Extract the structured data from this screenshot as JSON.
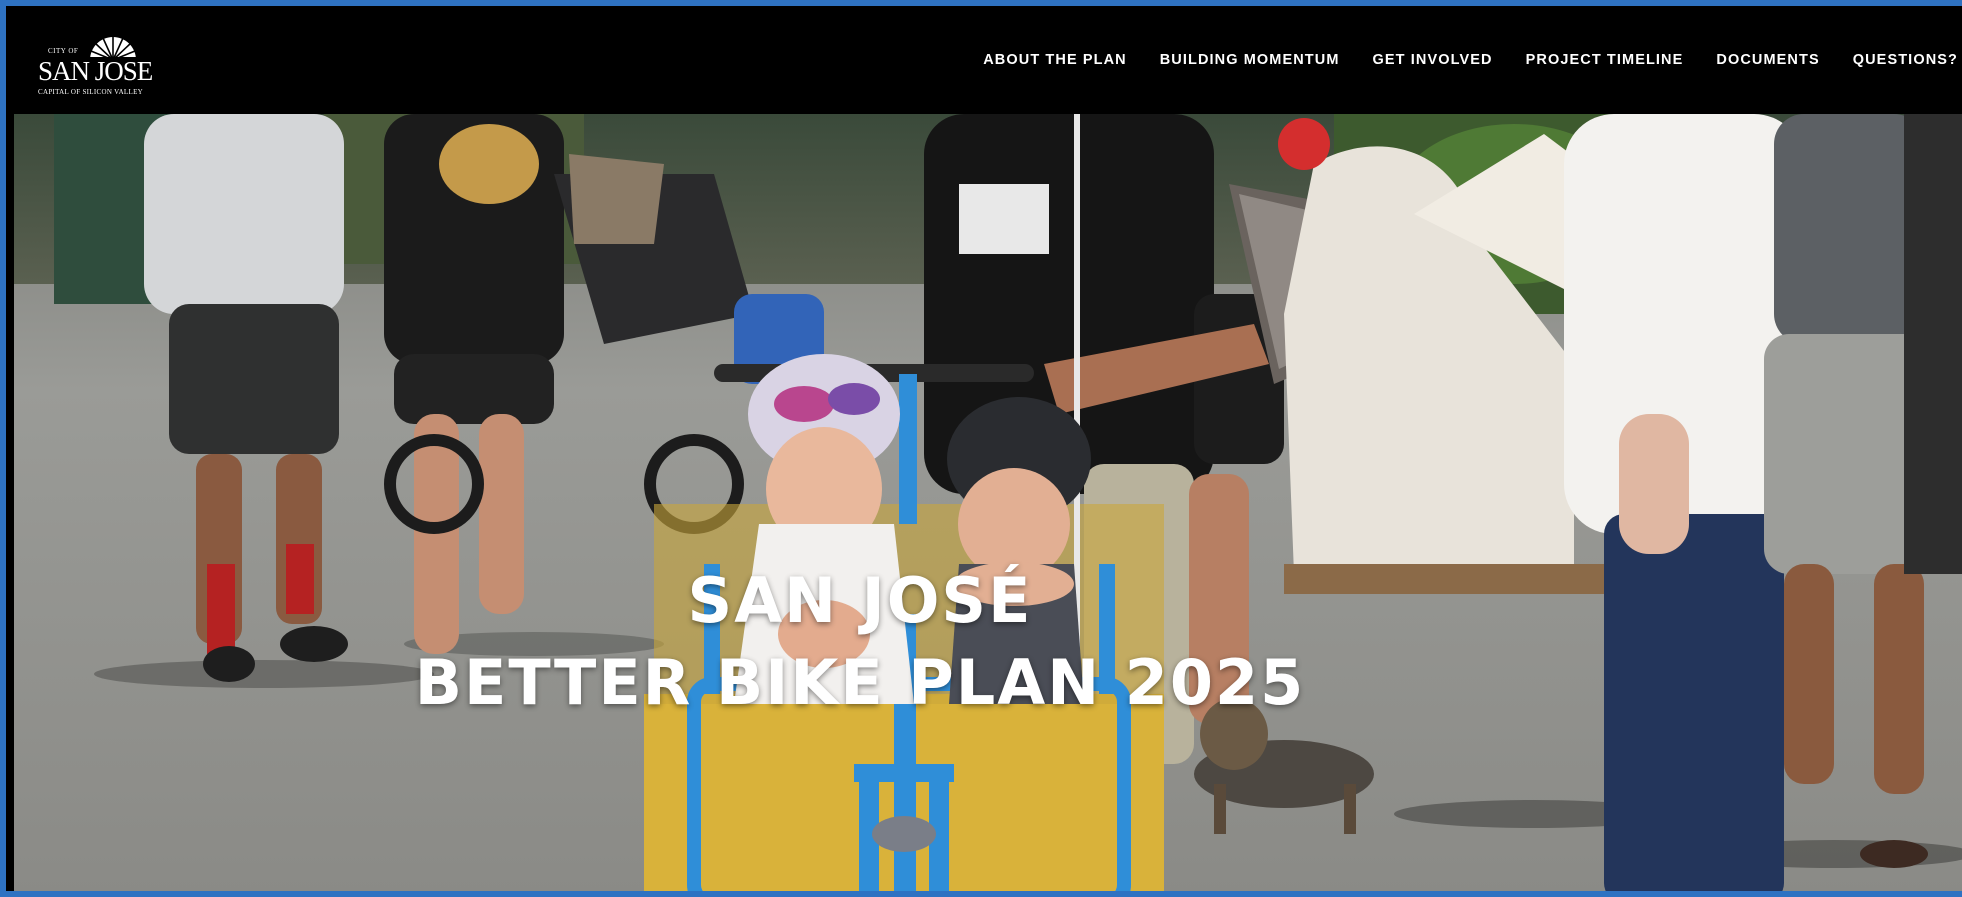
{
  "brand": {
    "city_small": "CITY OF",
    "name": "SAN JOSE",
    "tagline": "CAPITAL OF SILICON VALLEY",
    "logo_icon": "sunburst-icon"
  },
  "nav": {
    "items": [
      {
        "label": "ABOUT THE PLAN"
      },
      {
        "label": "BUILDING MOMENTUM"
      },
      {
        "label": "GET INVOLVED"
      },
      {
        "label": "PROJECT TIMELINE"
      },
      {
        "label": "DOCUMENTS"
      },
      {
        "label": "QUESTIONS?"
      }
    ]
  },
  "hero": {
    "line1": "SAN JOSÉ",
    "line2": "BETTER BIKE PLAN 2025"
  },
  "colors": {
    "nav_bg": "#000000",
    "frame_border": "#2e72c2",
    "text": "#ffffff",
    "cargo_box": "#d9b23a",
    "bike_frame": "#2f8ed8"
  }
}
